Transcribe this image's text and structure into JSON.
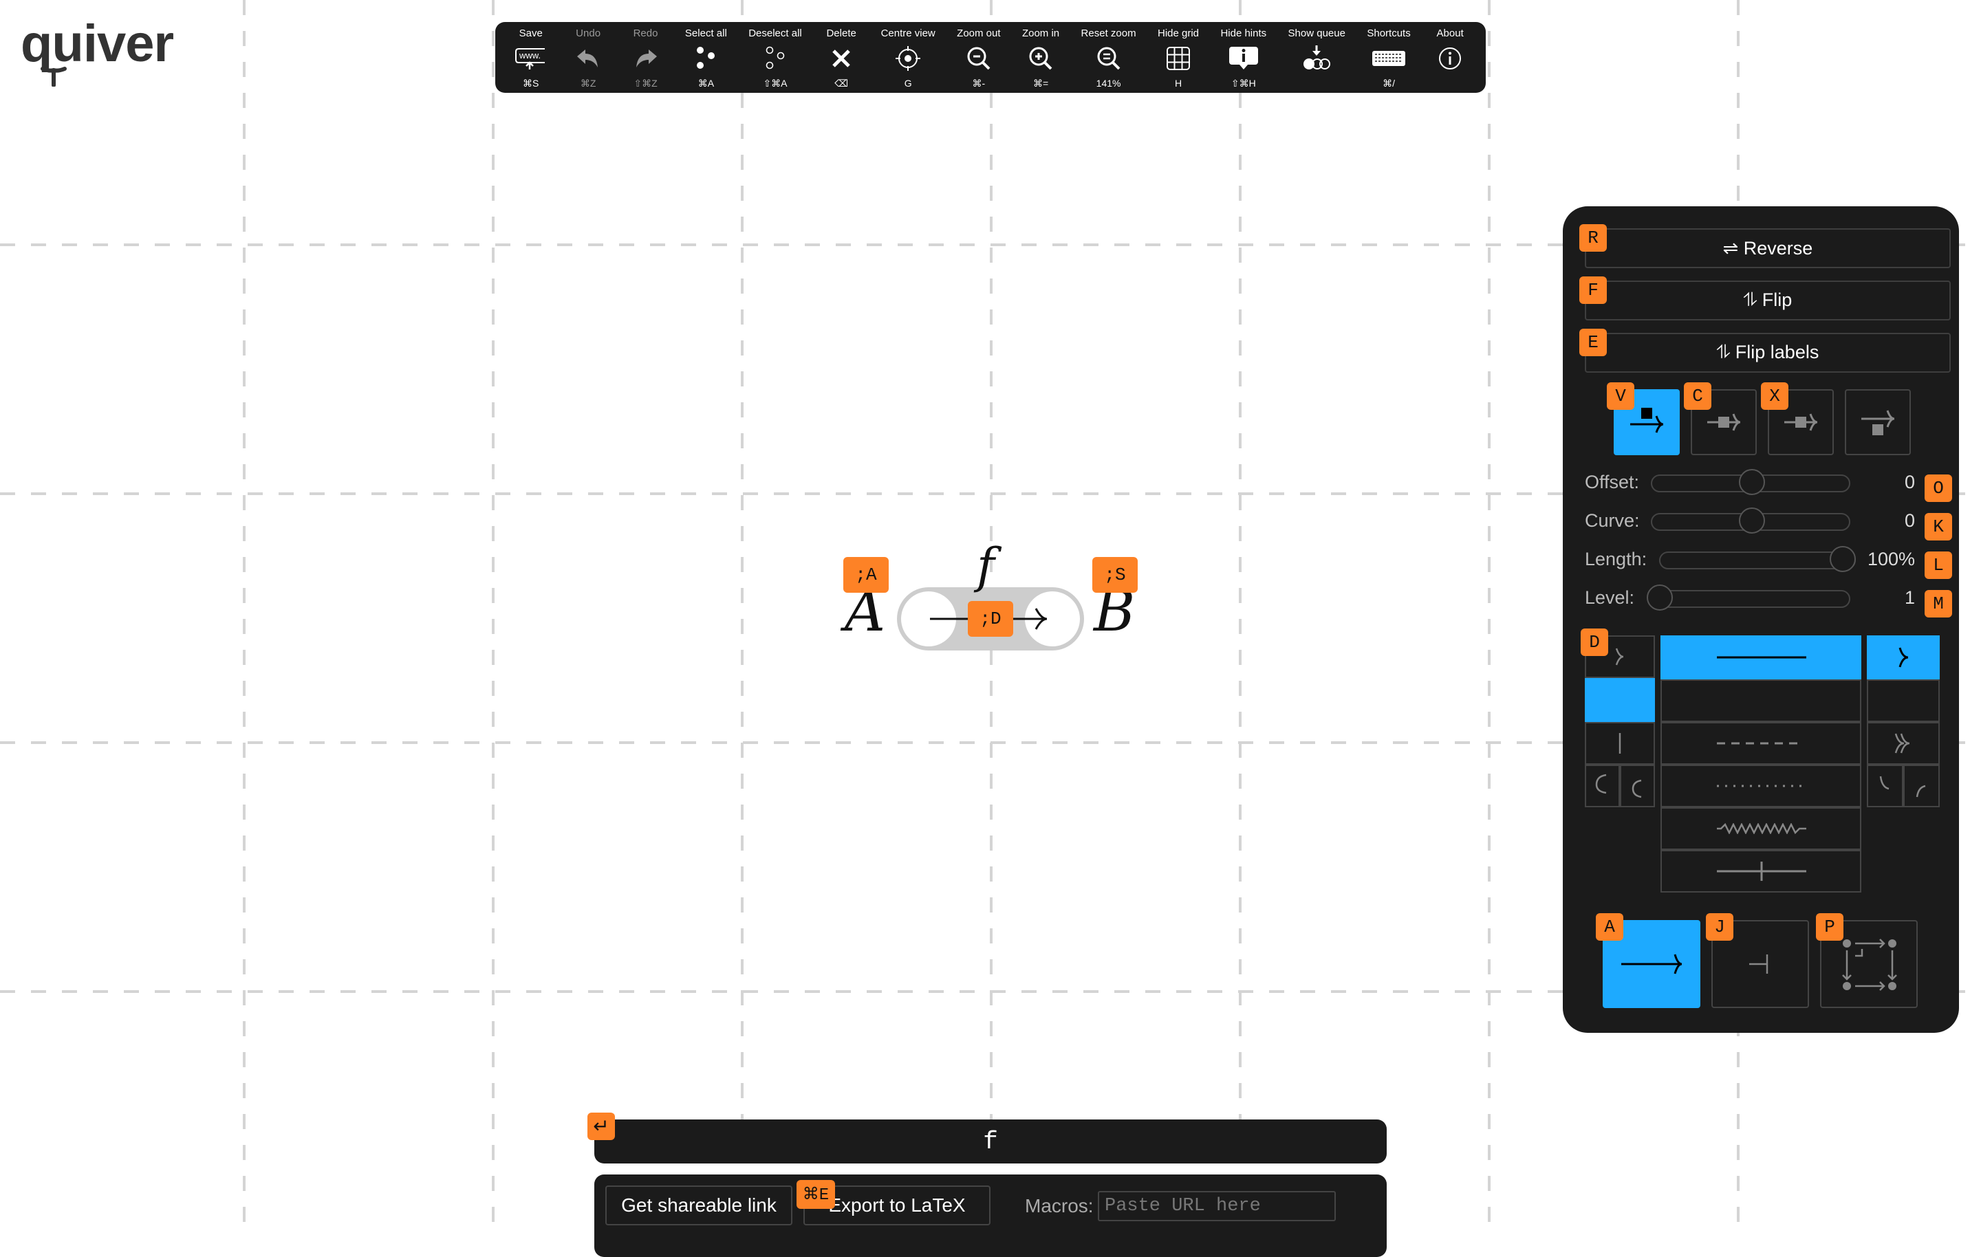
{
  "app": {
    "logo": "quiver"
  },
  "toolbar": {
    "items": [
      {
        "label": "Save",
        "key": "⌘S",
        "icon": "save-url-icon",
        "enabled": true
      },
      {
        "label": "Undo",
        "key": "⌘Z",
        "icon": "undo-icon",
        "enabled": false
      },
      {
        "label": "Redo",
        "key": "⇧⌘Z",
        "icon": "redo-icon",
        "enabled": false
      },
      {
        "label": "Select all",
        "key": "⌘A",
        "icon": "select-all-icon",
        "enabled": true
      },
      {
        "label": "Deselect all",
        "key": "⇧⌘A",
        "icon": "deselect-all-icon",
        "enabled": true
      },
      {
        "label": "Delete",
        "key": "⌫",
        "icon": "delete-icon",
        "enabled": true
      },
      {
        "label": "Centre view",
        "key": "G",
        "icon": "centre-view-icon",
        "enabled": true
      },
      {
        "label": "Zoom out",
        "key": "⌘-",
        "icon": "zoom-out-icon",
        "enabled": true
      },
      {
        "label": "Zoom in",
        "key": "⌘=",
        "icon": "zoom-in-icon",
        "enabled": true
      },
      {
        "label": "Reset zoom",
        "key": "141%",
        "icon": "reset-zoom-icon",
        "enabled": true
      },
      {
        "label": "Hide grid",
        "key": "H",
        "icon": "grid-icon",
        "enabled": true
      },
      {
        "label": "Hide hints",
        "key": "⇧⌘H",
        "icon": "hints-icon",
        "enabled": true
      },
      {
        "label": "Show queue",
        "key": "",
        "icon": "queue-icon",
        "enabled": true
      },
      {
        "label": "Shortcuts",
        "key": "⌘/",
        "icon": "keyboard-icon",
        "enabled": true
      },
      {
        "label": "About",
        "key": "",
        "icon": "info-icon",
        "enabled": true
      }
    ]
  },
  "diagram": {
    "source": {
      "label": "A",
      "hint": ";A"
    },
    "target": {
      "label": "B",
      "hint": ";S"
    },
    "edge": {
      "label": "f",
      "hint": ";D"
    }
  },
  "panel": {
    "reverse": {
      "label": "⇌ Reverse",
      "hint": "R"
    },
    "flip": {
      "label": "⥮ Flip",
      "hint": "F"
    },
    "flip_labels": {
      "label": "⥮ Flip labels",
      "hint": "E"
    },
    "label_positions": [
      {
        "name": "left",
        "hint": "V",
        "selected": true
      },
      {
        "name": "centre",
        "hint": "C",
        "selected": false
      },
      {
        "name": "over",
        "hint": "X",
        "selected": false
      },
      {
        "name": "right",
        "hint": "",
        "selected": false
      }
    ],
    "sliders": [
      {
        "label": "Offset:",
        "value": "0",
        "hint": "O",
        "fraction": 0.5
      },
      {
        "label": "Curve:",
        "value": "0",
        "hint": "K",
        "fraction": 0.5
      },
      {
        "label": "Length:",
        "value": "100%",
        "hint": "L",
        "fraction": 1.0
      },
      {
        "label": "Level:",
        "value": "1",
        "hint": "M",
        "fraction": 0.0
      }
    ],
    "style_hint": "D",
    "tail_styles": [
      "arrowhead",
      "none (selected)",
      "maps to",
      "hook top",
      "hook bottom"
    ],
    "body_styles": [
      "solid (selected)",
      "none",
      "dashed",
      "dotted",
      "squiggly",
      "barred"
    ],
    "head_styles": [
      "arrowhead (selected)",
      "none",
      "two-headed",
      "harpoon top",
      "harpoon bottom"
    ],
    "edge_types": [
      {
        "name": "arrow",
        "hint": "A",
        "selected": true
      },
      {
        "name": "adjunction",
        "hint": "J",
        "selected": false
      },
      {
        "name": "pullback",
        "hint": "P",
        "selected": false
      }
    ]
  },
  "label_input": {
    "value": "f",
    "hint": "↵"
  },
  "export": {
    "share_label": "Get shareable link",
    "latex_label": "Export to LaTeX",
    "latex_hint": "⌘E",
    "macros_label": "Macros:",
    "macros_placeholder": "Paste URL here"
  },
  "colors": {
    "accent": "#1daaff",
    "hint": "#fd8226",
    "panel": "#1b1b1b"
  }
}
